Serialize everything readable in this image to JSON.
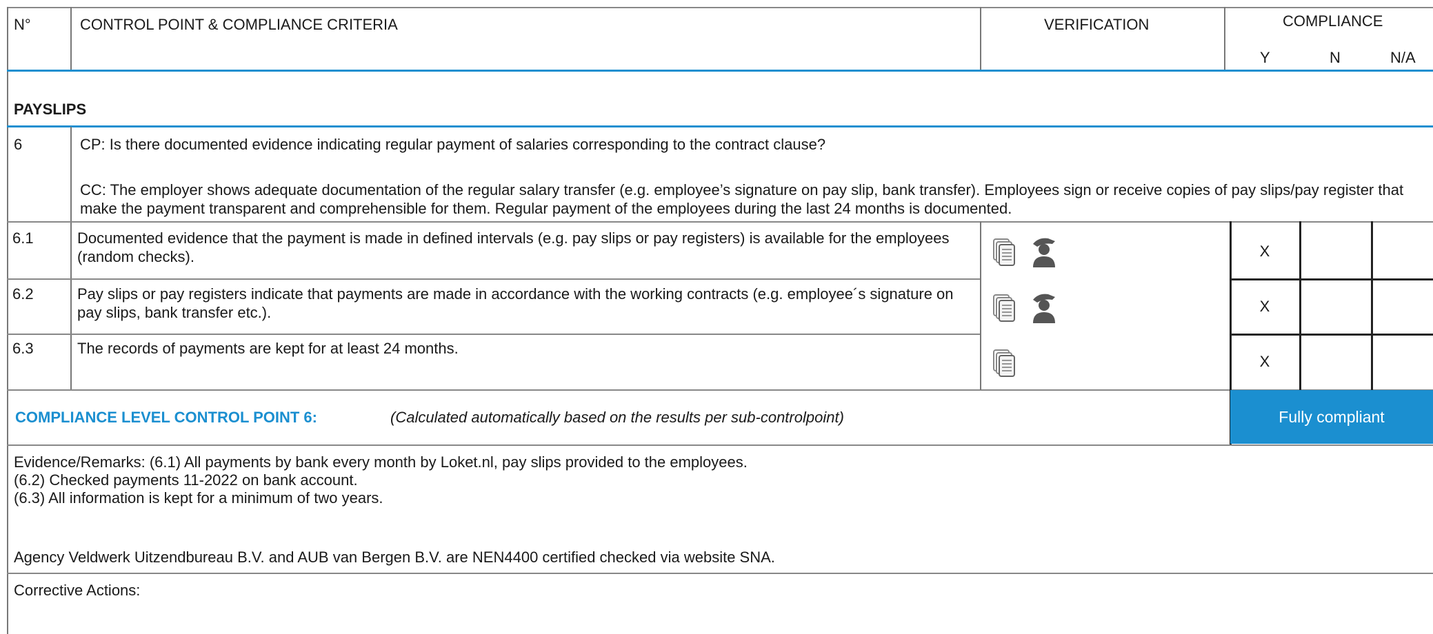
{
  "header": {
    "col_no": "N°",
    "col_criteria": "CONTROL POINT & COMPLIANCE CRITERIA",
    "col_verification": "VERIFICATION",
    "col_compliance": "COMPLIANCE",
    "col_y": "Y",
    "col_n": "N",
    "col_na": "N/A"
  },
  "section": {
    "title": "PAYSLIPS"
  },
  "control_point": {
    "number": "6",
    "cp_text": "CP: Is there documented evidence indicating regular payment of salaries corresponding to the contract clause?",
    "cc_text": "CC: The employer shows adequate documentation of the regular salary transfer (e.g. employee’s signature on pay slip, bank transfer). Employees sign or receive copies of pay slips/pay register that make the payment transparent and comprehensible for them. Regular payment of the employees during the last 24 months is documented."
  },
  "sub_points": [
    {
      "number": "6.1",
      "text": "Documented evidence that the payment is made in defined intervals (e.g. pay slips or pay registers) is available for the employees (random checks).",
      "verification_icons": [
        "document-icon",
        "interview-person-icon"
      ],
      "y": "X",
      "n": "",
      "na": ""
    },
    {
      "number": "6.2",
      "text": "Pay slips or pay registers indicate that payments are made in accordance with the working contracts (e.g. employee´s signature on pay slips, bank transfer etc.).",
      "verification_icons": [
        "document-icon",
        "interview-person-icon"
      ],
      "y": "X",
      "n": "",
      "na": ""
    },
    {
      "number": "6.3",
      "text": "The records of payments are kept for at least 24 months.",
      "verification_icons": [
        "document-icon"
      ],
      "y": "X",
      "n": "",
      "na": ""
    }
  ],
  "compliance_level": {
    "label": "COMPLIANCE LEVEL CONTROL POINT 6:",
    "note": "(Calculated automatically based on the results per sub-controlpoint)",
    "result": "Fully compliant"
  },
  "evidence": {
    "line1": "Evidence/Remarks: (6.1) All payments by bank every month by Loket.nl, pay slips provided to the employees.",
    "line2": "(6.2) Checked payments 11-2022 on bank account.",
    "line3": "(6.3) All information is kept for a minimum of two years.",
    "line4": "Agency Veldwerk Uitzendbureau B.V. and AUB van Bergen B.V. are NEN4400 certified checked via website SNA."
  },
  "corrective": {
    "label": "Corrective Actions:"
  },
  "colors": {
    "accent": "#1b8fd0",
    "result_bg": "#1b8fd0"
  }
}
